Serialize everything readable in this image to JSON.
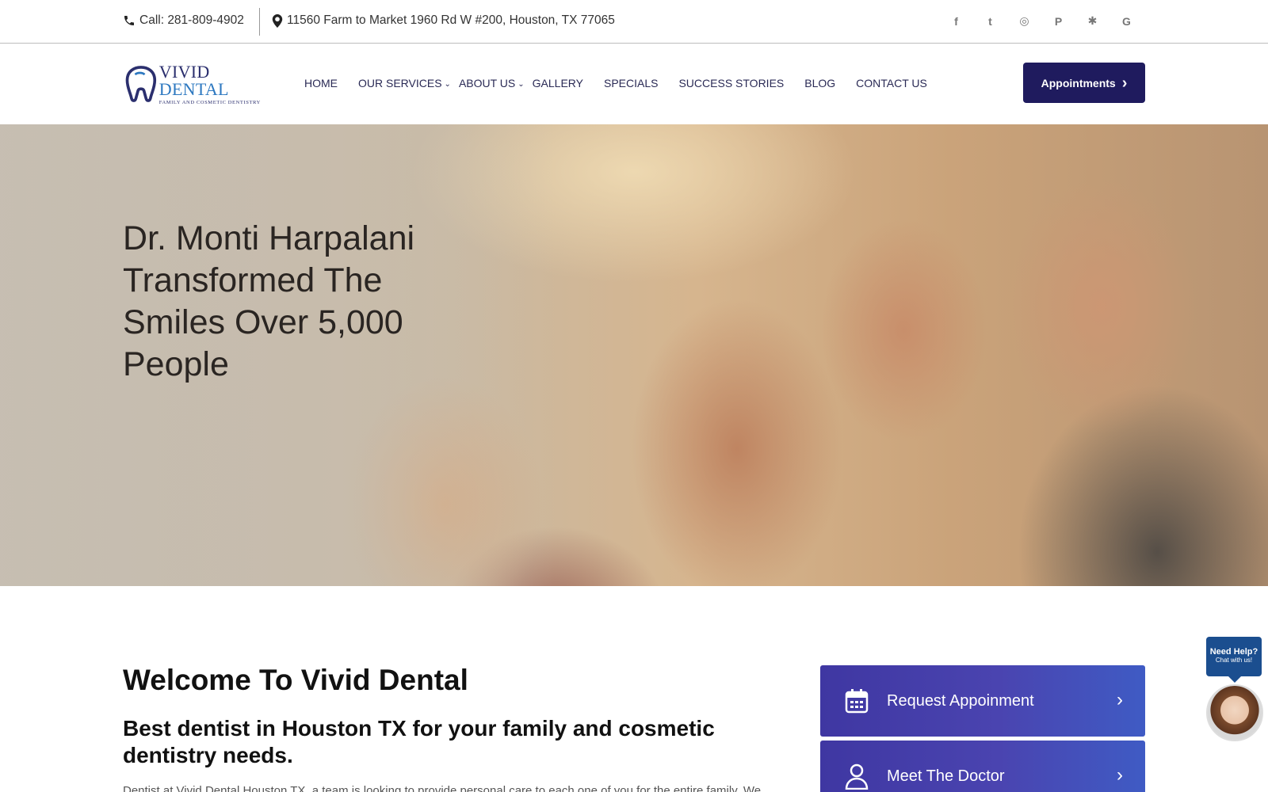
{
  "topbar": {
    "phone": "Call: 281-809-4902",
    "address": "11560 Farm to Market 1960 Rd W #200, Houston, TX 77065",
    "socials": [
      "facebook-icon",
      "twitter-icon",
      "instagram-icon",
      "pinterest-icon",
      "yelp-icon",
      "google-icon"
    ],
    "social_glyphs": [
      "f",
      "t",
      "◎",
      "P",
      "✱",
      "G"
    ]
  },
  "nav": {
    "logo": {
      "brand_a": "VIVID",
      "brand_b": " DENTAL",
      "tagline": "FAMILY AND COSMETIC DENTISTRY"
    },
    "items": [
      {
        "label": "HOME"
      },
      {
        "label": "OUR SERVICES",
        "chevron": "⌄"
      },
      {
        "label": "ABOUT US",
        "chevron": "⌄"
      },
      {
        "label": "GALLERY"
      },
      {
        "label": "SPECIALS"
      },
      {
        "label": "SUCCESS STORIES"
      },
      {
        "label": "BLOG"
      },
      {
        "label": "CONTACT US"
      }
    ],
    "appointments": "Appointments",
    "appointments_arrow": "›"
  },
  "hero": {
    "headline": "Dr. Monti Harpalani Transformed The Smiles Over 5,000 People"
  },
  "welcome": {
    "title": "Welcome To Vivid Dental",
    "subtitle": "Best dentist in Houston TX for your family and cosmetic dentistry needs.",
    "body": "Dentist at Vivid Dental Houston TX, a team is looking to provide personal care to each one of you for the entire family. We"
  },
  "cards": {
    "request": "Request Appoinment",
    "doctor": "Meet The Doctor",
    "arrow": "›"
  },
  "chat": {
    "line1": "Need Help?",
    "line2": "Chat with us!"
  },
  "colors": {
    "nav_button": "#1f1b5e",
    "card_gradient_start": "#3f37a2",
    "card_gradient_end": "#3f5bc4",
    "chat_blue": "#1b4e8f"
  }
}
